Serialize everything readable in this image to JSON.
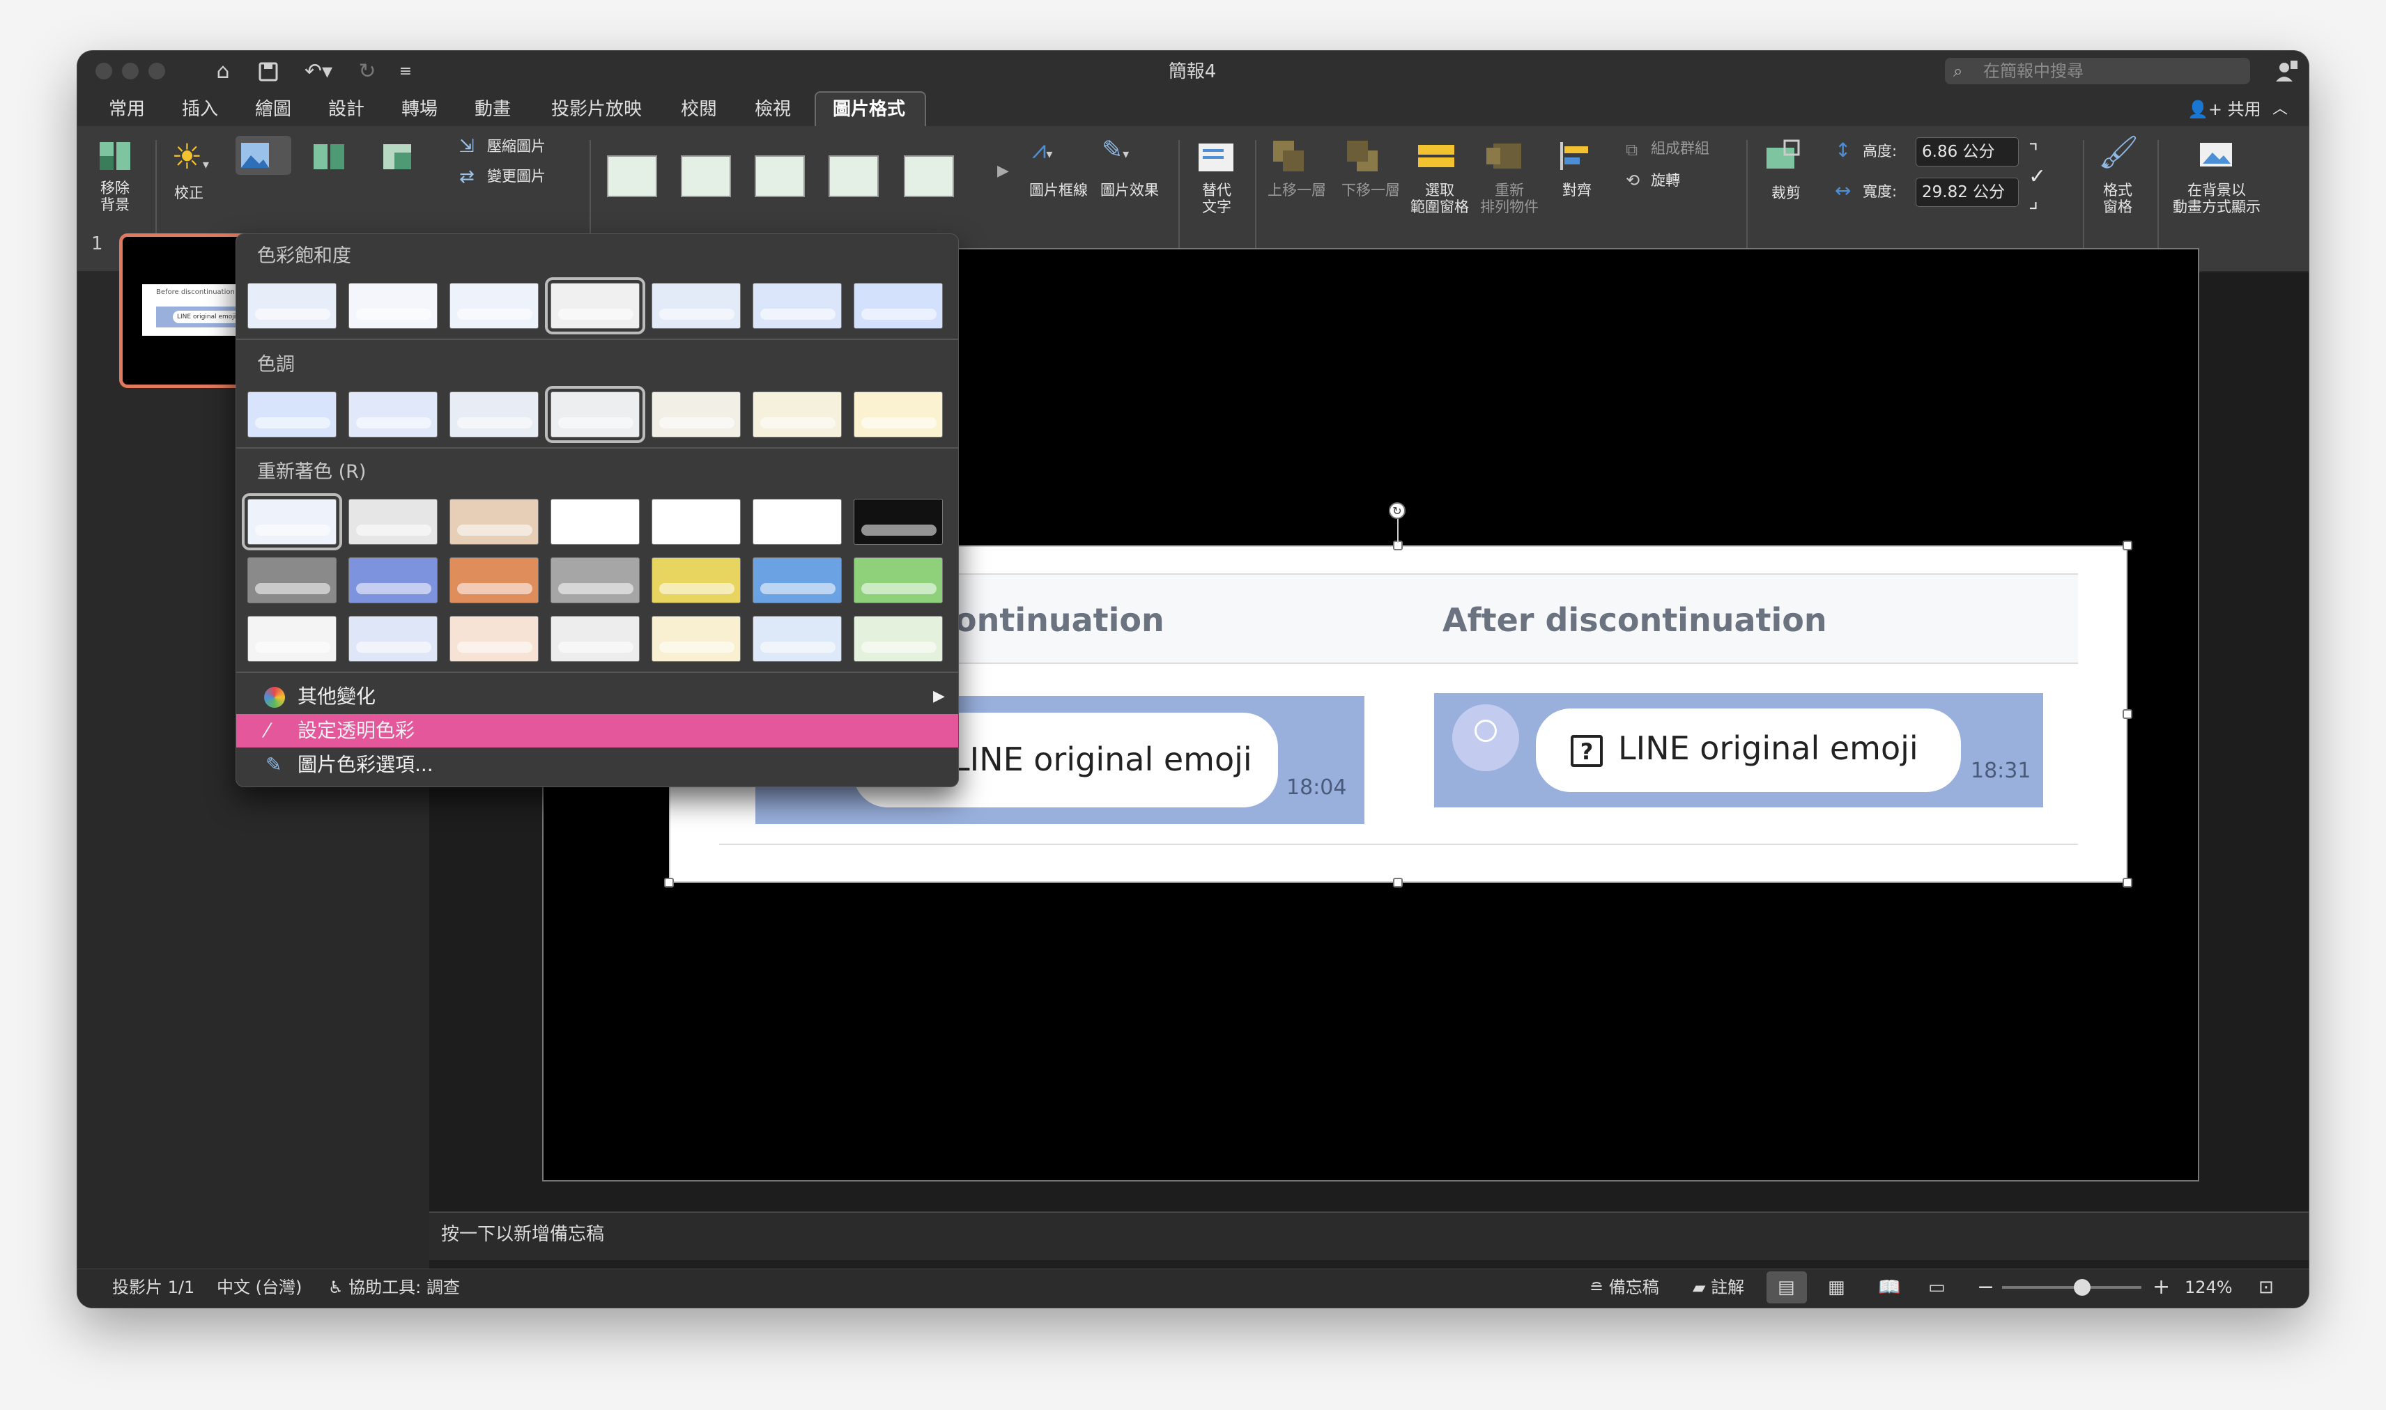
{
  "window": {
    "title": "簡報4",
    "search_placeholder": "在簡報中搜尋"
  },
  "tabs": [
    {
      "label": "常用"
    },
    {
      "label": "插入"
    },
    {
      "label": "繪圖"
    },
    {
      "label": "設計"
    },
    {
      "label": "轉場"
    },
    {
      "label": "動畫"
    },
    {
      "label": "投影片放映"
    },
    {
      "label": "校閱"
    },
    {
      "label": "檢視"
    },
    {
      "label": "圖片格式",
      "active": true
    }
  ],
  "share_label": "共用",
  "ribbon": {
    "remove_bg": [
      "移除",
      "背景"
    ],
    "corrections": "校正",
    "compress": "壓縮圖片",
    "change_picture": "變更圖片",
    "picture_border": "圖片框線",
    "picture_effects": "圖片效果",
    "alt_text": [
      "替代",
      "文字"
    ],
    "bring_forward": "上移一層",
    "send_backward": "下移一層",
    "selection_pane": [
      "選取",
      "範圍窗格"
    ],
    "reorder": [
      "重新",
      "排列物件"
    ],
    "align": "對齊",
    "group": "組成群組",
    "rotate": "旋轉",
    "crop": "裁剪",
    "height_label": "高度:",
    "height_value": "6.86 公分",
    "width_label": "寬度:",
    "width_value": "29.82 公分",
    "format_pane": [
      "格式",
      "窗格"
    ],
    "animate_bg": [
      "在背景以",
      "動畫方式顯示"
    ]
  },
  "dropdown": {
    "saturation_title": "色彩飽和度",
    "tone_title": "色調",
    "recolor_title": "重新著色 (R)",
    "more_variations": "其他變化",
    "set_transparent": "設定透明色彩",
    "color_options": "圖片色彩選項...",
    "saturation_swatches": [
      "#e8eef9",
      "#f4f6fb",
      "#eef2fa",
      "#f0f0f0",
      "#e3ebf9",
      "#dbe6fb",
      "#d3e1fc"
    ],
    "tone_swatches": [
      "#d8e4fb",
      "#e0e8fa",
      "#e8ecf4",
      "#eceef0",
      "#f1efe6",
      "#f6f1dc",
      "#fbf2d2"
    ],
    "recolor_row1": [
      "#eef2fa",
      "#e6e6e6",
      "#e6cfb6",
      "#ffffff",
      "#ffffff",
      "#ffffff",
      "#111111"
    ],
    "recolor_row2": [
      "#8a8a8a",
      "#7e93de",
      "#e08d5c",
      "#a6a6a6",
      "#e8d560",
      "#6aa2e4",
      "#8fd07a"
    ],
    "recolor_row3": [
      "#f4f4f4",
      "#dfe6f7",
      "#f6e3d6",
      "#ededed",
      "#f8f0d0",
      "#dde9f8",
      "#e4f1dc"
    ]
  },
  "slide_number": "1",
  "slide": {
    "header_left": "ontinuation",
    "header_right": "After discontinuation",
    "message": "LINE original emoji",
    "time_left": "18:04",
    "time_right": "18:31",
    "thumb_title": "Before discontinuation",
    "thumb_msg": "LINE original emoji"
  },
  "notes_placeholder": "按一下以新增備忘稿",
  "status": {
    "slide_count": "投影片 1/1",
    "language": "中文 (台灣)",
    "accessibility": "協助工具: 調查",
    "notes": "備忘稿",
    "comments": "註解",
    "zoom": "124%"
  },
  "colors": {
    "highlight": "#e4579b",
    "thumb_border": "#e07a5f",
    "chat_bg": "#99b0dd"
  }
}
